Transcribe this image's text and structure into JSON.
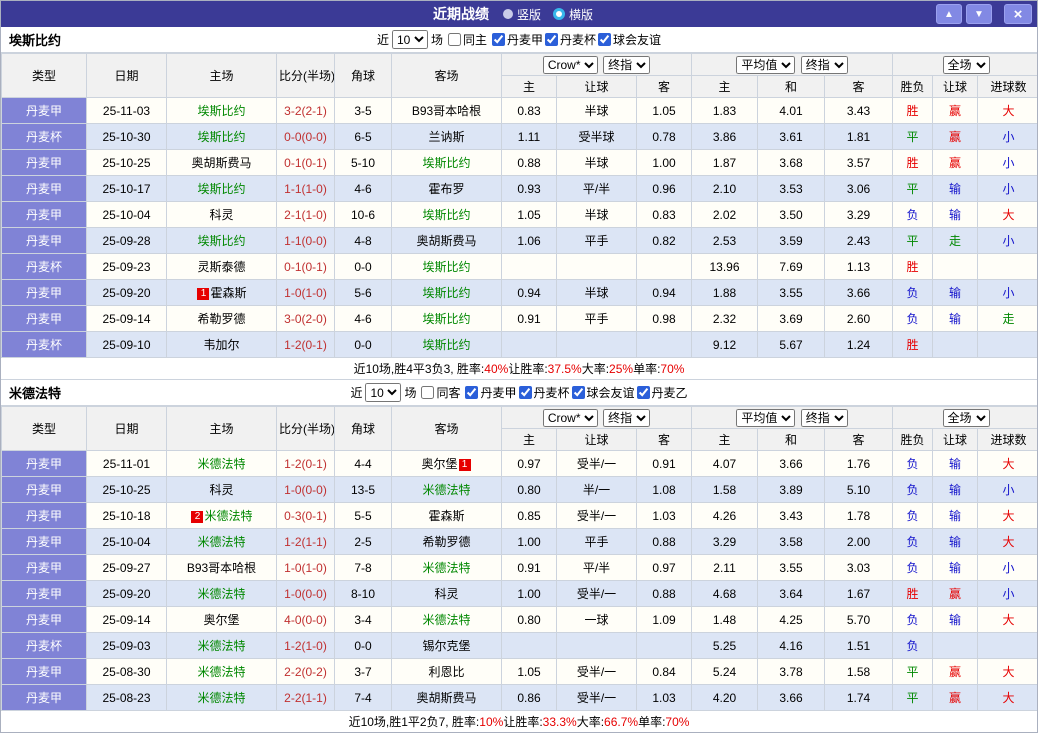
{
  "topbar": {
    "title": "近期战绩",
    "radio_vertical": "竖版",
    "radio_horizontal": "横版",
    "selected": "横版"
  },
  "icons": {
    "up_arrow": "▲",
    "down_arrow": "▼",
    "close": "×"
  },
  "controls": {
    "near": "近",
    "games": "场",
    "count": "10"
  },
  "table_header": {
    "col_type": "类型",
    "col_date": "日期",
    "col_home": "主场",
    "col_score": "比分(半场)",
    "col_corner": "角球",
    "col_away": "客场",
    "odds_select1": "Crow*",
    "odds_select2": "终指",
    "odds_sub": [
      "主",
      "让球",
      "客"
    ],
    "avg_select1": "平均值",
    "avg_select2": "终指",
    "avg_sub": [
      "主",
      "和",
      "客"
    ],
    "result_select": "全场",
    "result_sub": [
      "胜负",
      "让球",
      "进球数"
    ]
  },
  "colors": {
    "topbar_bg": "#3B3A96",
    "type_cell_bg": "#8083D6",
    "row_alt_bg": "#DCE5F5",
    "focal_team": "#008800",
    "win_red": "#E60000",
    "draw_green": "#008800",
    "loss_blue": "#1414CC",
    "score_red": "#C03030"
  },
  "sections": [
    {
      "team": "埃斯比约",
      "same_side": {
        "label": "同主",
        "checked": false
      },
      "leagues": [
        {
          "label": "丹麦甲",
          "checked": true
        },
        {
          "label": "丹麦杯",
          "checked": true
        },
        {
          "label": "球会友谊",
          "checked": true
        }
      ],
      "rows": [
        {
          "type": "丹麦甲",
          "date": "25-11-03",
          "home": {
            "name": "埃斯比约",
            "focal": true
          },
          "score": "3-2(2-1)",
          "corner": "3-5",
          "away": {
            "name": "B93哥本哈根"
          },
          "odds": [
            "0.83",
            "半球",
            "1.05"
          ],
          "avg": [
            "1.83",
            "4.01",
            "3.43"
          ],
          "res": [
            "胜",
            "r"
          ],
          "let": [
            "赢",
            "r"
          ],
          "goal": [
            "大",
            "r"
          ]
        },
        {
          "type": "丹麦杯",
          "date": "25-10-30",
          "home": {
            "name": "埃斯比约",
            "focal": true
          },
          "score": "0-0(0-0)",
          "corner": "6-5",
          "away": {
            "name": "兰讷斯"
          },
          "odds": [
            "1.11",
            "受半球",
            "0.78"
          ],
          "avg": [
            "3.86",
            "3.61",
            "1.81"
          ],
          "res": [
            "平",
            "g"
          ],
          "let": [
            "赢",
            "r"
          ],
          "goal": [
            "小",
            "b"
          ]
        },
        {
          "type": "丹麦甲",
          "date": "25-10-25",
          "home": {
            "name": "奥胡斯费马"
          },
          "score": "0-1(0-1)",
          "corner": "5-10",
          "away": {
            "name": "埃斯比约",
            "focal": true
          },
          "odds": [
            "0.88",
            "半球",
            "1.00"
          ],
          "avg": [
            "1.87",
            "3.68",
            "3.57"
          ],
          "res": [
            "胜",
            "r"
          ],
          "let": [
            "赢",
            "r"
          ],
          "goal": [
            "小",
            "b"
          ]
        },
        {
          "type": "丹麦甲",
          "date": "25-10-17",
          "home": {
            "name": "埃斯比约",
            "focal": true
          },
          "score": "1-1(1-0)",
          "corner": "4-6",
          "away": {
            "name": "霍布罗"
          },
          "odds": [
            "0.93",
            "平/半",
            "0.96"
          ],
          "avg": [
            "2.10",
            "3.53",
            "3.06"
          ],
          "res": [
            "平",
            "g"
          ],
          "let": [
            "输",
            "b"
          ],
          "goal": [
            "小",
            "b"
          ]
        },
        {
          "type": "丹麦甲",
          "date": "25-10-04",
          "home": {
            "name": "科灵"
          },
          "score": "2-1(1-0)",
          "corner": "10-6",
          "away": {
            "name": "埃斯比约",
            "focal": true
          },
          "odds": [
            "1.05",
            "半球",
            "0.83"
          ],
          "avg": [
            "2.02",
            "3.50",
            "3.29"
          ],
          "res": [
            "负",
            "b"
          ],
          "let": [
            "输",
            "b"
          ],
          "goal": [
            "大",
            "r"
          ]
        },
        {
          "type": "丹麦甲",
          "date": "25-09-28",
          "home": {
            "name": "埃斯比约",
            "focal": true
          },
          "score": "1-1(0-0)",
          "corner": "4-8",
          "away": {
            "name": "奥胡斯费马"
          },
          "odds": [
            "1.06",
            "平手",
            "0.82"
          ],
          "avg": [
            "2.53",
            "3.59",
            "2.43"
          ],
          "res": [
            "平",
            "g"
          ],
          "let": [
            "走",
            "g"
          ],
          "goal": [
            "小",
            "b"
          ]
        },
        {
          "type": "丹麦杯",
          "date": "25-09-23",
          "home": {
            "name": "灵斯泰德"
          },
          "score": "0-1(0-1)",
          "corner": "0-0",
          "away": {
            "name": "埃斯比约",
            "focal": true
          },
          "odds": [
            "",
            "",
            ""
          ],
          "avg": [
            "13.96",
            "7.69",
            "1.13"
          ],
          "res": [
            "胜",
            "r"
          ],
          "let": [
            "",
            ""
          ],
          "goal": [
            "",
            ""
          ]
        },
        {
          "type": "丹麦甲",
          "date": "25-09-20",
          "home": {
            "name": "霍森斯",
            "badge_before": "1"
          },
          "score": "1-0(1-0)",
          "corner": "5-6",
          "away": {
            "name": "埃斯比约",
            "focal": true
          },
          "odds": [
            "0.94",
            "半球",
            "0.94"
          ],
          "avg": [
            "1.88",
            "3.55",
            "3.66"
          ],
          "res": [
            "负",
            "b"
          ],
          "let": [
            "输",
            "b"
          ],
          "goal": [
            "小",
            "b"
          ]
        },
        {
          "type": "丹麦甲",
          "date": "25-09-14",
          "home": {
            "name": "希勒罗德"
          },
          "score": "3-0(2-0)",
          "corner": "4-6",
          "away": {
            "name": "埃斯比约",
            "focal": true
          },
          "odds": [
            "0.91",
            "平手",
            "0.98"
          ],
          "avg": [
            "2.32",
            "3.69",
            "2.60"
          ],
          "res": [
            "负",
            "b"
          ],
          "let": [
            "输",
            "b"
          ],
          "goal": [
            "走",
            "g"
          ]
        },
        {
          "type": "丹麦杯",
          "date": "25-09-10",
          "home": {
            "name": "韦加尔"
          },
          "score": "1-2(0-1)",
          "corner": "0-0",
          "away": {
            "name": "埃斯比约",
            "focal": true
          },
          "odds": [
            "",
            "",
            ""
          ],
          "avg": [
            "9.12",
            "5.67",
            "1.24"
          ],
          "res": [
            "胜",
            "r"
          ],
          "let": [
            "",
            ""
          ],
          "goal": [
            "",
            ""
          ]
        }
      ],
      "summary": [
        {
          "text": "近10场,胜4平3负3, 胜率:",
          "red": false
        },
        {
          "text": "40%",
          "red": true
        },
        {
          "text": " 让胜率:",
          "red": false
        },
        {
          "text": "37.5%",
          "red": true
        },
        {
          "text": " 大率:",
          "red": false
        },
        {
          "text": "25%",
          "red": true
        },
        {
          "text": " 单率:",
          "red": false
        },
        {
          "text": "70%",
          "red": true
        }
      ]
    },
    {
      "team": "米德法特",
      "same_side": {
        "label": "同客",
        "checked": false
      },
      "leagues": [
        {
          "label": "丹麦甲",
          "checked": true
        },
        {
          "label": "丹麦杯",
          "checked": true
        },
        {
          "label": "球会友谊",
          "checked": true
        },
        {
          "label": "丹麦乙",
          "checked": true
        }
      ],
      "rows": [
        {
          "type": "丹麦甲",
          "date": "25-11-01",
          "home": {
            "name": "米德法特",
            "focal": true
          },
          "score": "1-2(0-1)",
          "corner": "4-4",
          "away": {
            "name": "奥尔堡",
            "badge_after": "1"
          },
          "odds": [
            "0.97",
            "受半/一",
            "0.91"
          ],
          "avg": [
            "4.07",
            "3.66",
            "1.76"
          ],
          "res": [
            "负",
            "b"
          ],
          "let": [
            "输",
            "b"
          ],
          "goal": [
            "大",
            "r"
          ]
        },
        {
          "type": "丹麦甲",
          "date": "25-10-25",
          "home": {
            "name": "科灵"
          },
          "score": "1-0(0-0)",
          "corner": "13-5",
          "away": {
            "name": "米德法特",
            "focal": true
          },
          "odds": [
            "0.80",
            "半/一",
            "1.08"
          ],
          "avg": [
            "1.58",
            "3.89",
            "5.10"
          ],
          "res": [
            "负",
            "b"
          ],
          "let": [
            "输",
            "b"
          ],
          "goal": [
            "小",
            "b"
          ]
        },
        {
          "type": "丹麦甲",
          "date": "25-10-18",
          "home": {
            "name": "米德法特",
            "focal": true,
            "badge_before": "2"
          },
          "score": "0-3(0-1)",
          "corner": "5-5",
          "away": {
            "name": "霍森斯"
          },
          "odds": [
            "0.85",
            "受半/一",
            "1.03"
          ],
          "avg": [
            "4.26",
            "3.43",
            "1.78"
          ],
          "res": [
            "负",
            "b"
          ],
          "let": [
            "输",
            "b"
          ],
          "goal": [
            "大",
            "r"
          ]
        },
        {
          "type": "丹麦甲",
          "date": "25-10-04",
          "home": {
            "name": "米德法特",
            "focal": true
          },
          "score": "1-2(1-1)",
          "corner": "2-5",
          "away": {
            "name": "希勒罗德"
          },
          "odds": [
            "1.00",
            "平手",
            "0.88"
          ],
          "avg": [
            "3.29",
            "3.58",
            "2.00"
          ],
          "res": [
            "负",
            "b"
          ],
          "let": [
            "输",
            "b"
          ],
          "goal": [
            "大",
            "r"
          ]
        },
        {
          "type": "丹麦甲",
          "date": "25-09-27",
          "home": {
            "name": "B93哥本哈根"
          },
          "score": "1-0(1-0)",
          "corner": "7-8",
          "away": {
            "name": "米德法特",
            "focal": true
          },
          "odds": [
            "0.91",
            "平/半",
            "0.97"
          ],
          "avg": [
            "2.11",
            "3.55",
            "3.03"
          ],
          "res": [
            "负",
            "b"
          ],
          "let": [
            "输",
            "b"
          ],
          "goal": [
            "小",
            "b"
          ]
        },
        {
          "type": "丹麦甲",
          "date": "25-09-20",
          "home": {
            "name": "米德法特",
            "focal": true
          },
          "score": "1-0(0-0)",
          "corner": "8-10",
          "away": {
            "name": "科灵"
          },
          "odds": [
            "1.00",
            "受半/一",
            "0.88"
          ],
          "avg": [
            "4.68",
            "3.64",
            "1.67"
          ],
          "res": [
            "胜",
            "r"
          ],
          "let": [
            "赢",
            "r"
          ],
          "goal": [
            "小",
            "b"
          ]
        },
        {
          "type": "丹麦甲",
          "date": "25-09-14",
          "home": {
            "name": "奥尔堡"
          },
          "score": "4-0(0-0)",
          "corner": "3-4",
          "away": {
            "name": "米德法特",
            "focal": true
          },
          "odds": [
            "0.80",
            "一球",
            "1.09"
          ],
          "avg": [
            "1.48",
            "4.25",
            "5.70"
          ],
          "res": [
            "负",
            "b"
          ],
          "let": [
            "输",
            "b"
          ],
          "goal": [
            "大",
            "r"
          ]
        },
        {
          "type": "丹麦杯",
          "date": "25-09-03",
          "home": {
            "name": "米德法特",
            "focal": true
          },
          "score": "1-2(1-0)",
          "corner": "0-0",
          "away": {
            "name": "锡尔克堡"
          },
          "odds": [
            "",
            "",
            ""
          ],
          "avg": [
            "5.25",
            "4.16",
            "1.51"
          ],
          "res": [
            "负",
            "b"
          ],
          "let": [
            "",
            ""
          ],
          "goal": [
            "",
            ""
          ]
        },
        {
          "type": "丹麦甲",
          "date": "25-08-30",
          "home": {
            "name": "米德法特",
            "focal": true
          },
          "score": "2-2(0-2)",
          "corner": "3-7",
          "away": {
            "name": "利恩比"
          },
          "odds": [
            "1.05",
            "受半/一",
            "0.84"
          ],
          "avg": [
            "5.24",
            "3.78",
            "1.58"
          ],
          "res": [
            "平",
            "g"
          ],
          "let": [
            "赢",
            "r"
          ],
          "goal": [
            "大",
            "r"
          ]
        },
        {
          "type": "丹麦甲",
          "date": "25-08-23",
          "home": {
            "name": "米德法特",
            "focal": true
          },
          "score": "2-2(1-1)",
          "corner": "7-4",
          "away": {
            "name": "奥胡斯费马"
          },
          "odds": [
            "0.86",
            "受半/一",
            "1.03"
          ],
          "avg": [
            "4.20",
            "3.66",
            "1.74"
          ],
          "res": [
            "平",
            "g"
          ],
          "let": [
            "赢",
            "r"
          ],
          "goal": [
            "大",
            "r"
          ]
        }
      ],
      "summary": [
        {
          "text": "近10场,胜1平2负7, 胜率:",
          "red": false
        },
        {
          "text": "10%",
          "red": true
        },
        {
          "text": " 让胜率:",
          "red": false
        },
        {
          "text": "33.3%",
          "red": true
        },
        {
          "text": " 大率:",
          "red": false
        },
        {
          "text": "66.7%",
          "red": true
        },
        {
          "text": " 单率:",
          "red": false
        },
        {
          "text": "70%",
          "red": true
        }
      ]
    }
  ]
}
